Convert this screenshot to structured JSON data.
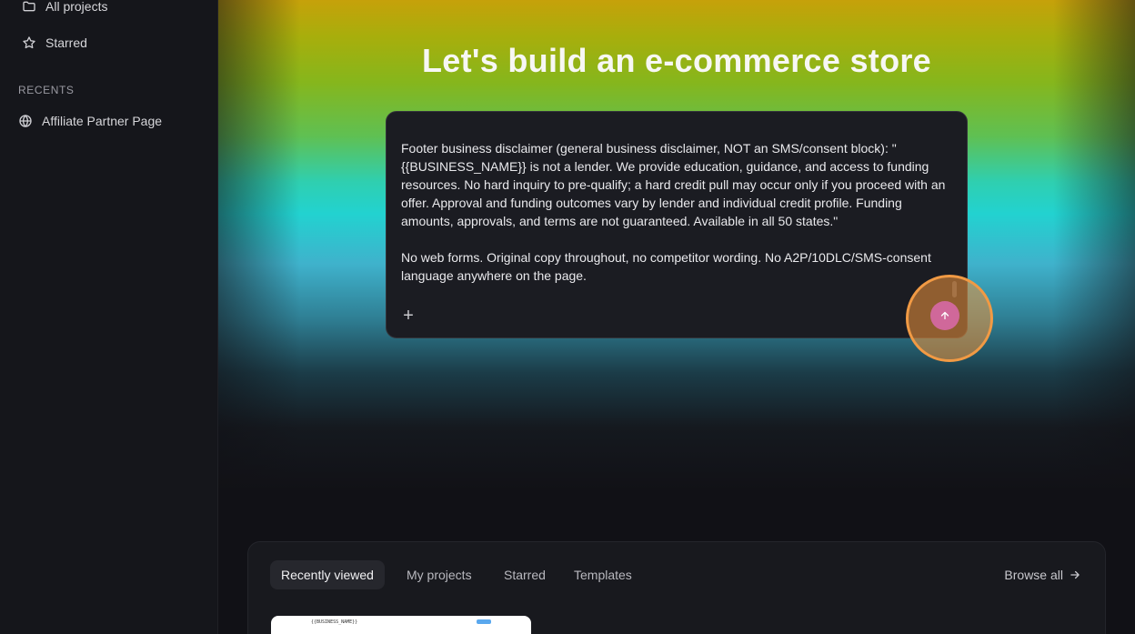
{
  "sidebar": {
    "all_projects": "All projects",
    "starred": "Starred",
    "recents_header": "RECENTS",
    "recent_items": [
      "Affiliate Partner Page"
    ]
  },
  "hero": {
    "title": "Let's build an e-commerce store"
  },
  "prompt": {
    "text": "Footer business disclaimer (general business disclaimer, NOT an SMS/consent block): \"{{BUSINESS_NAME}} is not a lender. We provide education, guidance, and access to funding resources. No hard inquiry to pre-qualify; a hard credit pull may occur only if you proceed with an offer. Approval and funding outcomes vary by lender and individual credit profile. Funding amounts, approvals, and terms are not guaranteed. Available in all 50 states.\"\n\nNo web forms. Original copy throughout, no competitor wording. No A2P/10DLC/SMS-consent language anywhere on the page.",
    "plus_label": "+",
    "send_icon": "arrow-up-icon"
  },
  "panel": {
    "tabs": [
      "Recently viewed",
      "My projects",
      "Starred",
      "Templates"
    ],
    "active_tab": 0,
    "browse_all": "Browse all",
    "thumbnail_text": "{{BUSINESS_NAME}}"
  },
  "colors": {
    "accent_send": "#d0689a",
    "highlight_ring": "#f19a44"
  }
}
